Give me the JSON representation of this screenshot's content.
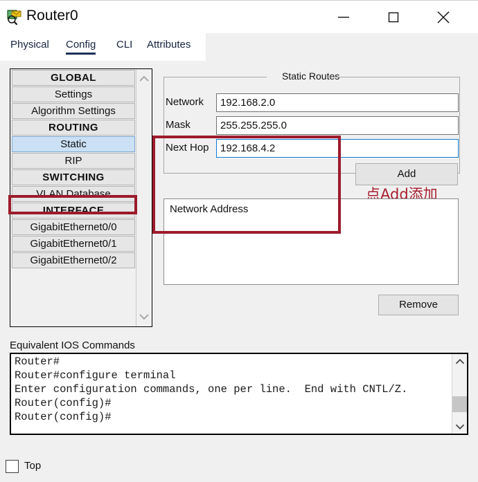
{
  "window": {
    "title": "Router0",
    "icon": "router-inspect-icon",
    "controls": {
      "minimize": "minimize-icon",
      "maximize": "maximize-icon",
      "close": "close-icon"
    }
  },
  "tabs": [
    {
      "label": "Physical",
      "active": false
    },
    {
      "label": "Config",
      "active": true
    },
    {
      "label": "CLI",
      "active": false
    },
    {
      "label": "Attributes",
      "active": false
    }
  ],
  "sidebar": {
    "items": [
      {
        "label": "GLOBAL",
        "type": "header",
        "selected": false
      },
      {
        "label": "Settings",
        "type": "item",
        "selected": false
      },
      {
        "label": "Algorithm Settings",
        "type": "item",
        "selected": false
      },
      {
        "label": "ROUTING",
        "type": "header",
        "selected": false
      },
      {
        "label": "Static",
        "type": "item",
        "selected": true
      },
      {
        "label": "RIP",
        "type": "item",
        "selected": false
      },
      {
        "label": "SWITCHING",
        "type": "header",
        "selected": false
      },
      {
        "label": "VLAN Database",
        "type": "item",
        "selected": false
      },
      {
        "label": "INTERFACE",
        "type": "header",
        "selected": false
      },
      {
        "label": "GigabitEthernet0/0",
        "type": "item",
        "selected": false
      },
      {
        "label": "GigabitEthernet0/1",
        "type": "item",
        "selected": false
      },
      {
        "label": "GigabitEthernet0/2",
        "type": "item",
        "selected": false
      }
    ],
    "scroll_up": "chevron-up-icon",
    "scroll_down": "chevron-down-icon"
  },
  "static_routes": {
    "legend": "Static Routes",
    "fields": [
      {
        "label": "Network",
        "value": "192.168.2.0",
        "focused": false
      },
      {
        "label": "Mask",
        "value": "255.255.255.0",
        "focused": false
      },
      {
        "label": "Next Hop",
        "value": "192.168.4.2",
        "focused": true
      }
    ],
    "add_button": "Add",
    "annotation": "点Add添加",
    "annotation_color": "#a81f2e",
    "list_header": "Network Address",
    "list_entries": [],
    "remove_button": "Remove"
  },
  "ios": {
    "label": "Equivalent IOS Commands",
    "text": "Router#\nRouter#configure terminal\nEnter configuration commands, one per line.  End with CNTL/Z.\nRouter(config)#\nRouter(config)#",
    "scroll_up": "chevron-up-icon",
    "scroll_down": "chevron-down-icon"
  },
  "bottom": {
    "top_checkbox_label": "Top",
    "top_checked": false
  },
  "colors": {
    "selected_item": "#cbe0f5",
    "focus_border": "#0d7ad6",
    "annotation_red": "#9c1b2c",
    "tab_text": "#15233f"
  }
}
